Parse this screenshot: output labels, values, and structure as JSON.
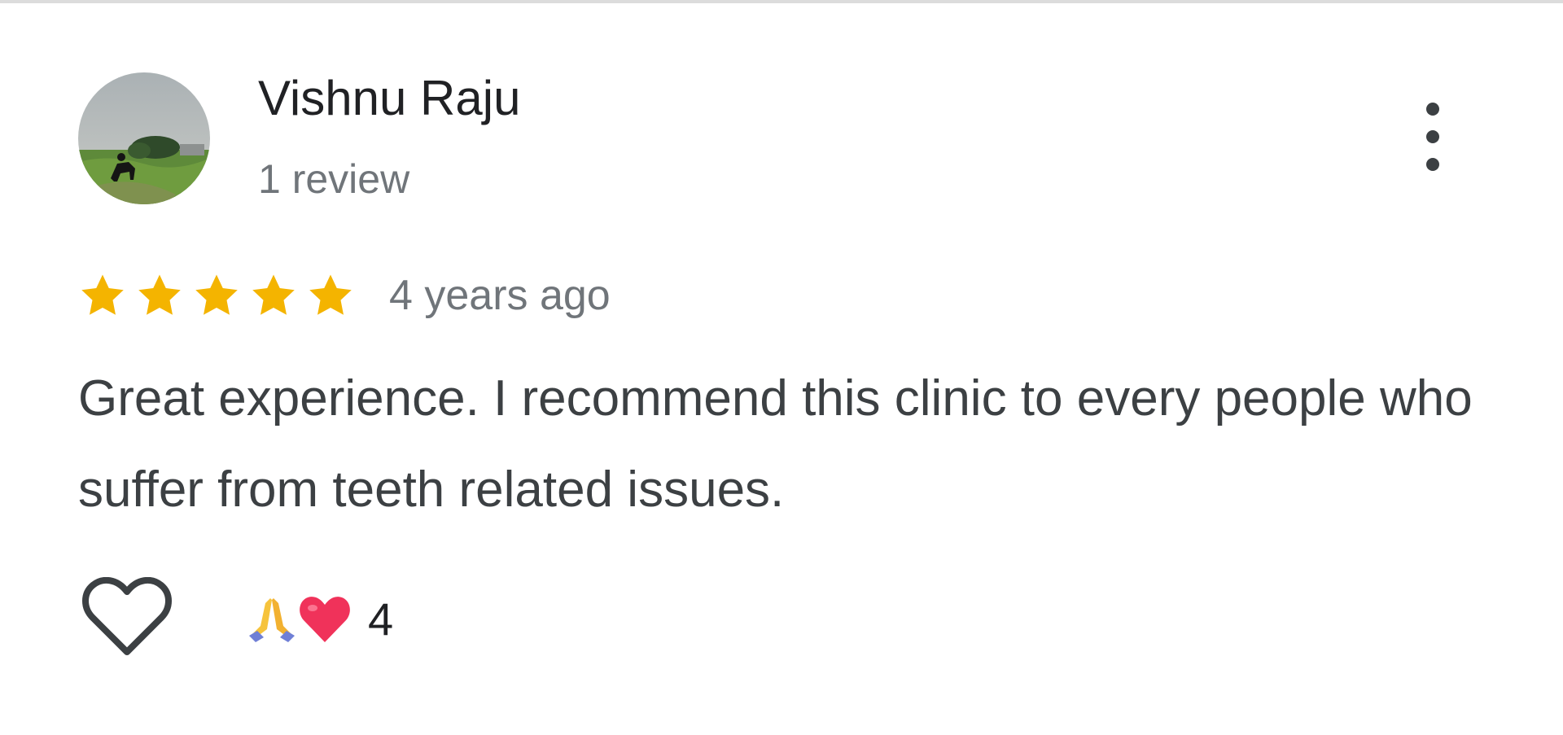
{
  "review": {
    "reviewer": {
      "name": "Vishnu Raju",
      "review_count": "1 review",
      "avatar": "profile-photo-horse-rider-landscape"
    },
    "menu_icon": "more-vertical-icon",
    "rating": {
      "stars": 5,
      "max": 5,
      "color": "#f4b400"
    },
    "time": "4 years ago",
    "text": "Great experience. I recommend this clinic to every people who suffer from teeth related issues.",
    "like_icon": "heart-outline-icon",
    "reactions": {
      "emojis": [
        "folded-hands-icon",
        "red-heart-icon"
      ],
      "count": "4"
    }
  }
}
